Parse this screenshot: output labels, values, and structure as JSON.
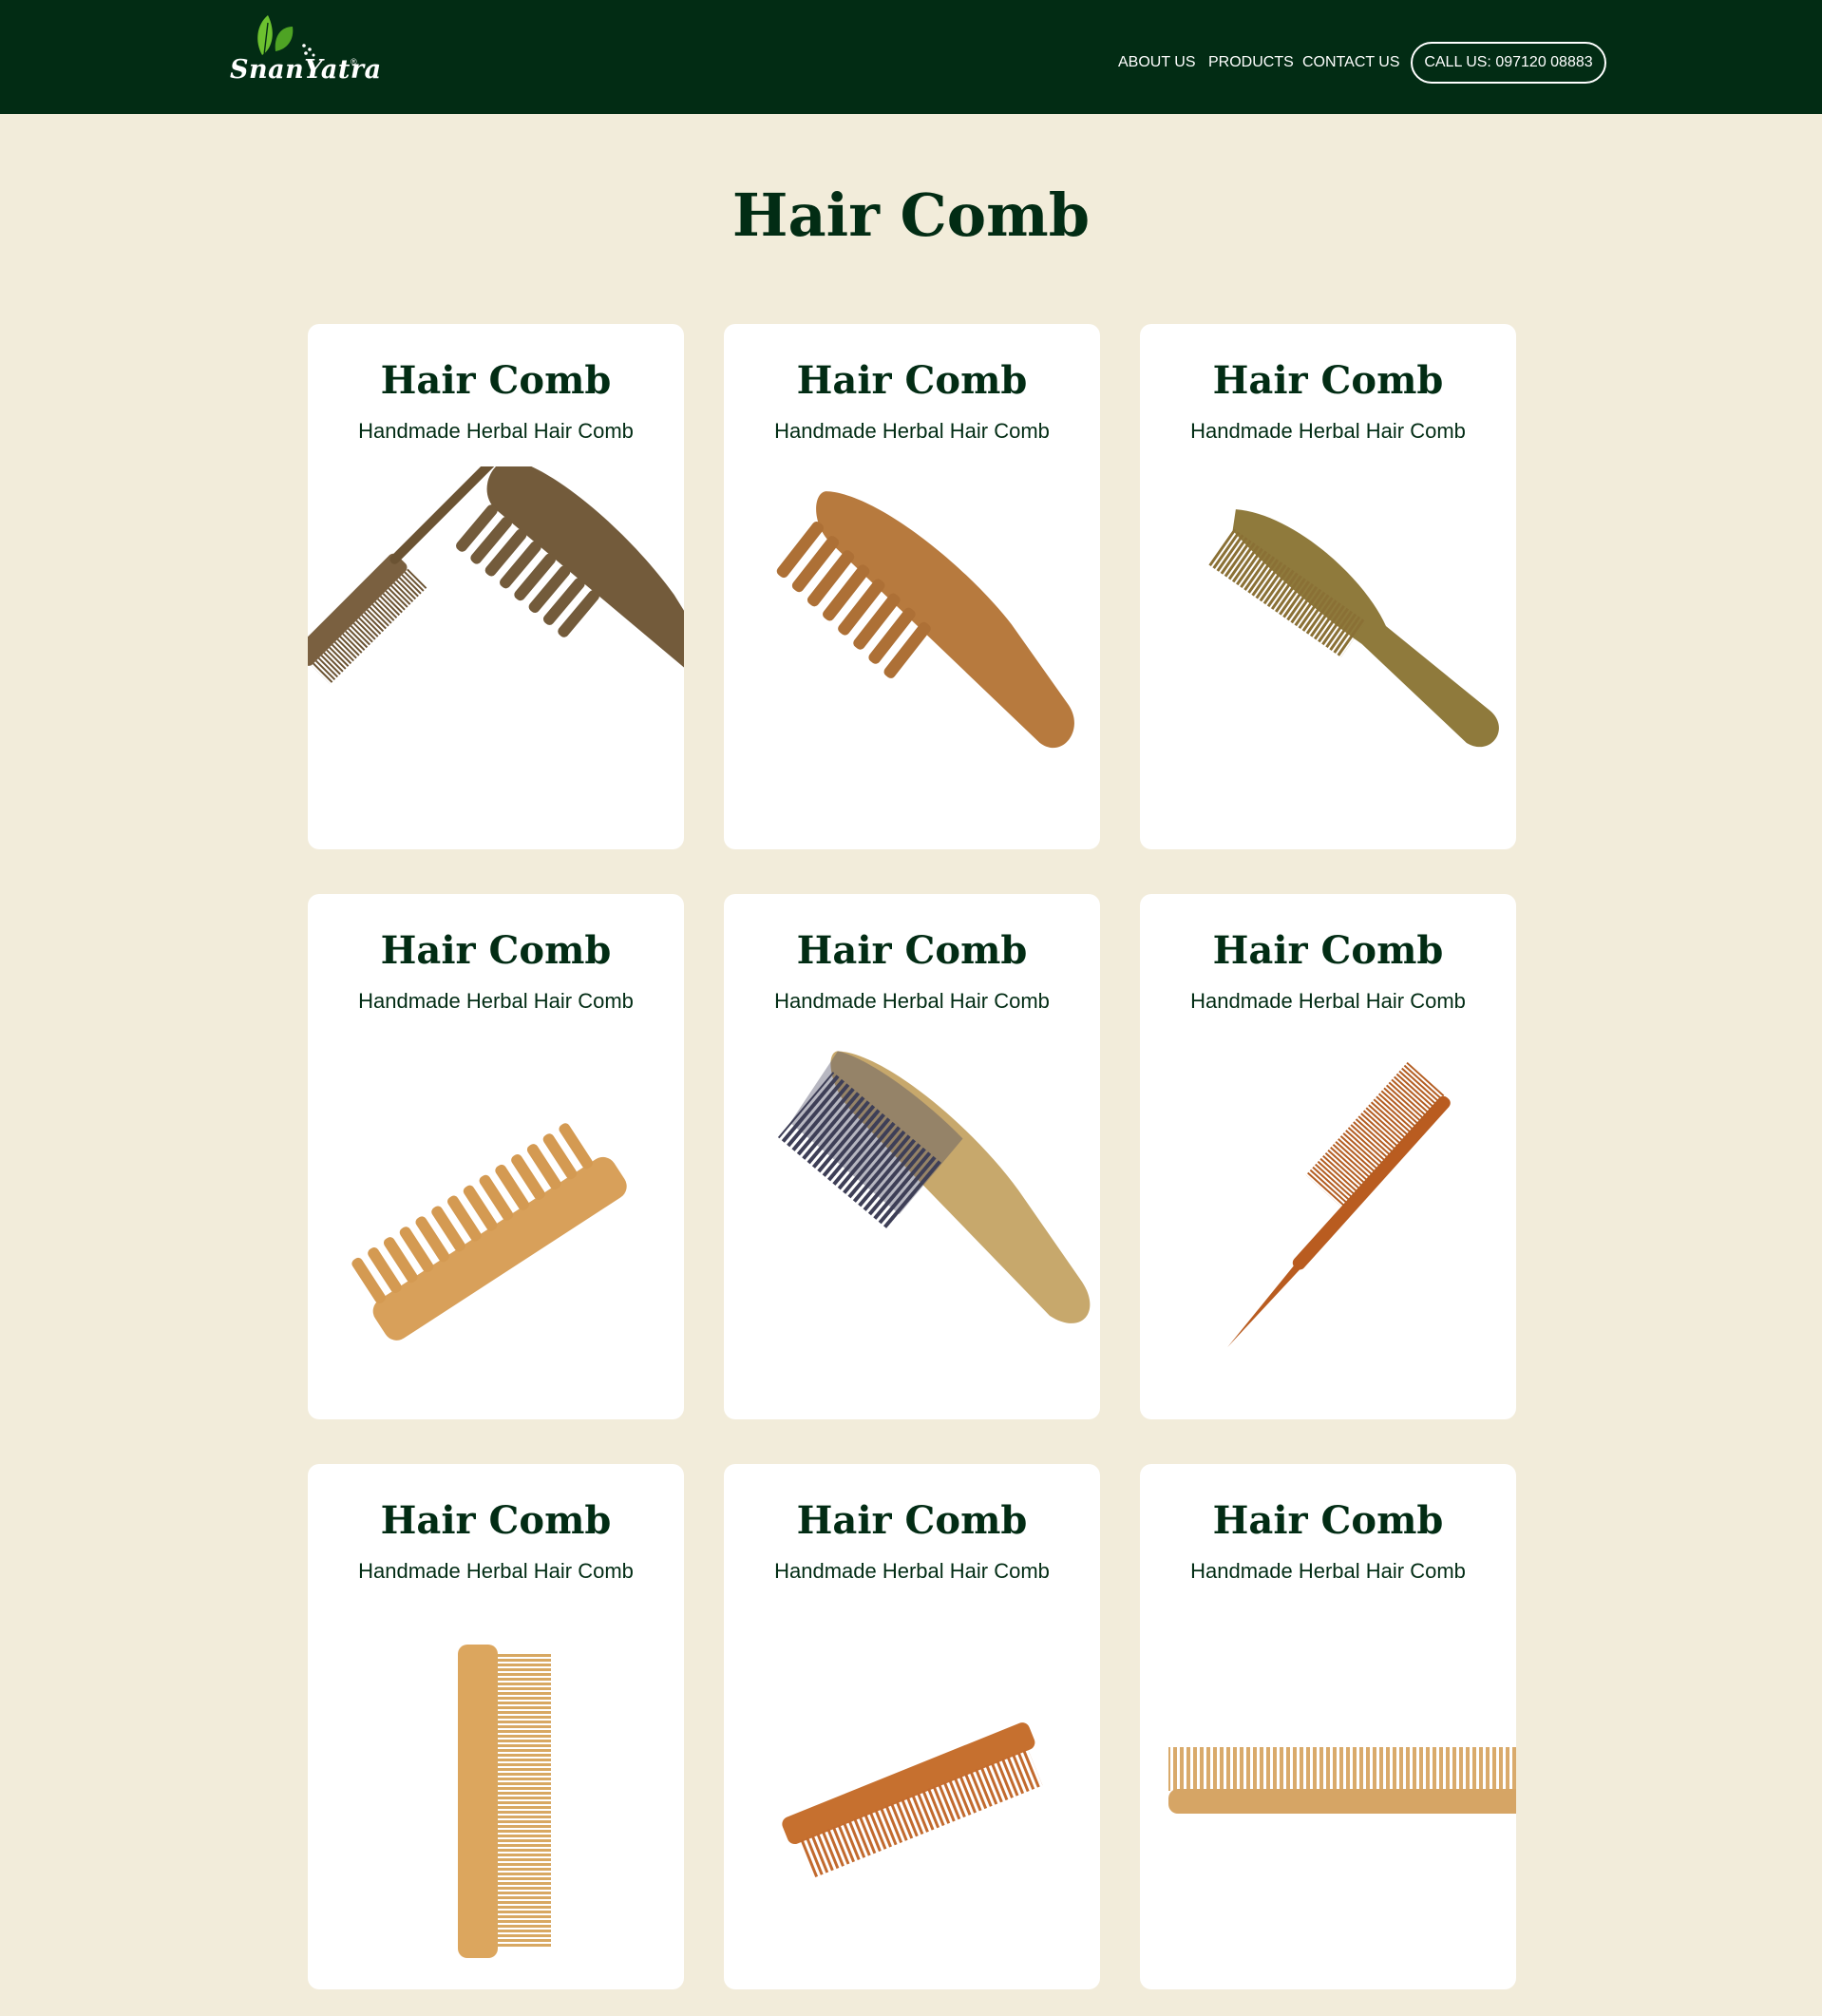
{
  "header": {
    "brand": "SnanYatra",
    "brand_mark": "®",
    "nav": [
      {
        "label": "ABOUT US"
      },
      {
        "label": "PRODUCTS"
      },
      {
        "label": "CONTACT US"
      }
    ],
    "call_label": "CALL US: 097120 08883",
    "colors": {
      "bg": "#022c14",
      "leaf": "#6cc12f"
    }
  },
  "main": {
    "title": "Hair Comb",
    "products": [
      {
        "title": "Hair Comb",
        "subtitle": "Handmade Herbal Hair Comb",
        "image": "double-wood-comb-icon"
      },
      {
        "title": "Hair Comb",
        "subtitle": "Handmade Herbal Hair Comb",
        "image": "wide-tooth-comb-icon"
      },
      {
        "title": "Hair Comb",
        "subtitle": "Handmade Herbal Hair Comb",
        "image": "fine-tooth-handle-comb-icon"
      },
      {
        "title": "Hair Comb",
        "subtitle": "Handmade Herbal Hair Comb",
        "image": "neem-wide-comb-icon"
      },
      {
        "title": "Hair Comb",
        "subtitle": "Handmade Herbal Hair Comb",
        "image": "horn-wood-comb-icon"
      },
      {
        "title": "Hair Comb",
        "subtitle": "Handmade Herbal Hair Comb",
        "image": "tail-comb-icon"
      },
      {
        "title": "Hair Comb",
        "subtitle": "Handmade Herbal Hair Comb",
        "image": "vertical-pocket-comb-icon"
      },
      {
        "title": "Hair Comb",
        "subtitle": "Handmade Herbal Hair Comb",
        "image": "tilted-pocket-comb-icon"
      },
      {
        "title": "Hair Comb",
        "subtitle": "Handmade Herbal Hair Comb",
        "image": "flat-pocket-comb-icon"
      }
    ]
  },
  "colors": {
    "page_bg": "#f2ecda",
    "text": "#022c14",
    "card_bg": "#ffffff"
  }
}
